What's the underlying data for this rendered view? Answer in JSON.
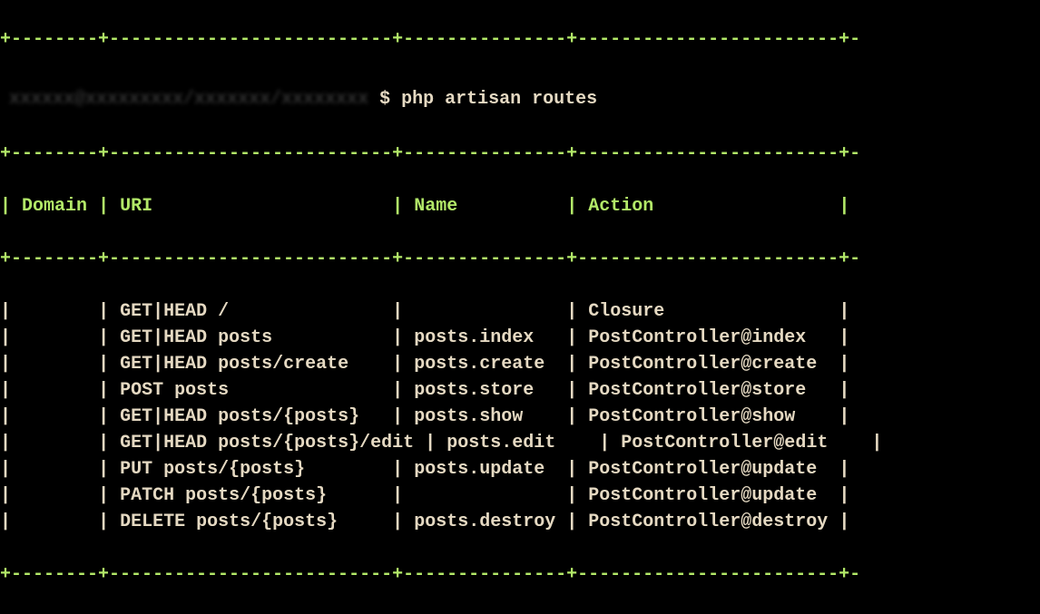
{
  "prompt": {
    "path_obscured": "xxxxxx@xxxxxxxxx/xxxxxxx/xxxxxxxx",
    "dollar": "$",
    "command": "php artisan routes"
  },
  "divider_top": "+--------+--------------------------+---------------+------------------------+-",
  "divider_mid": "+--------+--------------------------+---------------+------------------------+-",
  "divider_bot": "+--------+--------------------------+---------------+------------------------+-",
  "headers": {
    "domain": "Domain",
    "uri": "URI",
    "name": "Name",
    "action": "Action"
  },
  "rows": [
    {
      "domain": "",
      "uri": "GET|HEAD /",
      "name": "",
      "action": "Closure"
    },
    {
      "domain": "",
      "uri": "GET|HEAD posts",
      "name": "posts.index",
      "action": "PostController@index"
    },
    {
      "domain": "",
      "uri": "GET|HEAD posts/create",
      "name": "posts.create",
      "action": "PostController@create"
    },
    {
      "domain": "",
      "uri": "POST posts",
      "name": "posts.store",
      "action": "PostController@store"
    },
    {
      "domain": "",
      "uri": "GET|HEAD posts/{posts}",
      "name": "posts.show",
      "action": "PostController@show"
    },
    {
      "domain": "",
      "uri": "GET|HEAD posts/{posts}/edit",
      "name": "posts.edit",
      "action": "PostController@edit"
    },
    {
      "domain": "",
      "uri": "PUT posts/{posts}",
      "name": "posts.update",
      "action": "PostController@update"
    },
    {
      "domain": "",
      "uri": "PATCH posts/{posts}",
      "name": "",
      "action": "PostController@update"
    },
    {
      "domain": "",
      "uri": "DELETE posts/{posts}",
      "name": "posts.destroy",
      "action": "PostController@destroy"
    }
  ],
  "col_widths": {
    "domain": 8,
    "uri": 26,
    "name": 15,
    "action": 24
  }
}
